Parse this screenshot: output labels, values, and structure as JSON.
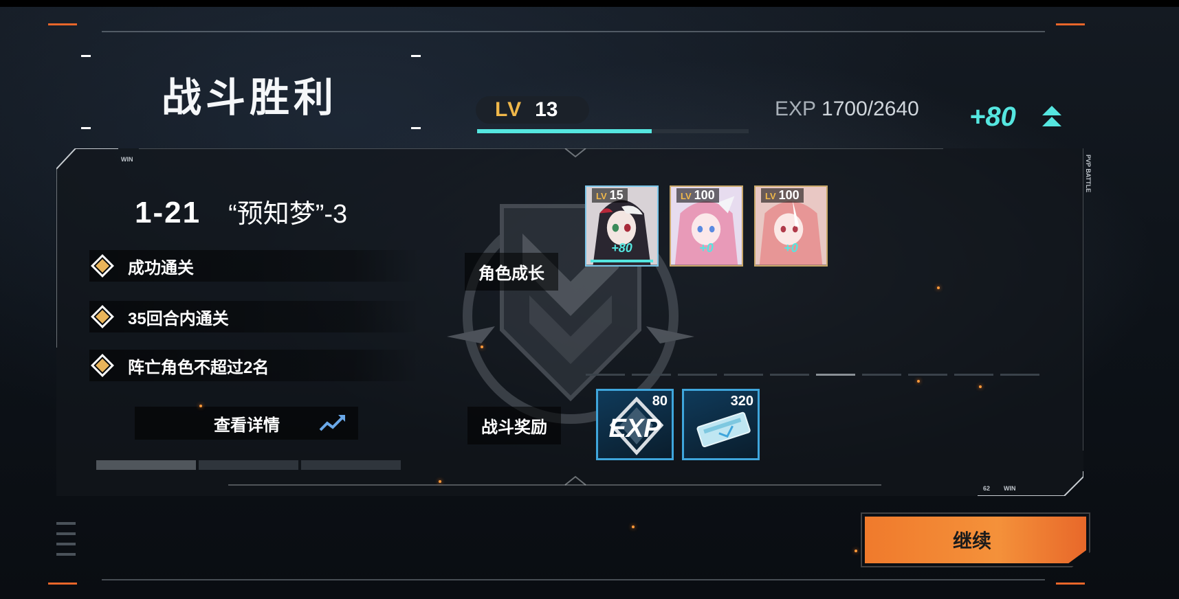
{
  "header": {
    "title": "战斗胜利",
    "level_label": "LV",
    "level_value": "13",
    "exp_label": "EXP",
    "exp_value": "1700/2640",
    "exp_progress": 0.644,
    "exp_gain": "+80"
  },
  "stage": {
    "code": "1-21",
    "name": "“预知梦”-3"
  },
  "conditions": [
    {
      "label": "成功通关"
    },
    {
      "label": "35回合内通关"
    },
    {
      "label": "阵亡角色不超过2名"
    }
  ],
  "detail_button": {
    "label": "查看详情"
  },
  "character_growth": {
    "label": "角色成长",
    "characters": [
      {
        "lv_label": "LV",
        "level": "15",
        "gain": "+80"
      },
      {
        "lv_label": "LV",
        "level": "100",
        "gain": "+0"
      },
      {
        "lv_label": "LV",
        "level": "100",
        "gain": "+0"
      }
    ]
  },
  "battle_rewards": {
    "label": "战斗奖励",
    "items": [
      {
        "name": "EXP",
        "count": "80"
      },
      {
        "name": "ticket",
        "count": "320"
      }
    ]
  },
  "continue_button": {
    "label": "继续"
  },
  "decor": {
    "win_tag": "WIN",
    "pvp_tag": "PVP BATTLE",
    "num_tag": "62"
  },
  "colors": {
    "accent_cyan": "#55e6e0",
    "accent_orange": "#f07a2c",
    "gold": "#e9b45a",
    "reward_border": "#3fa6dc"
  }
}
